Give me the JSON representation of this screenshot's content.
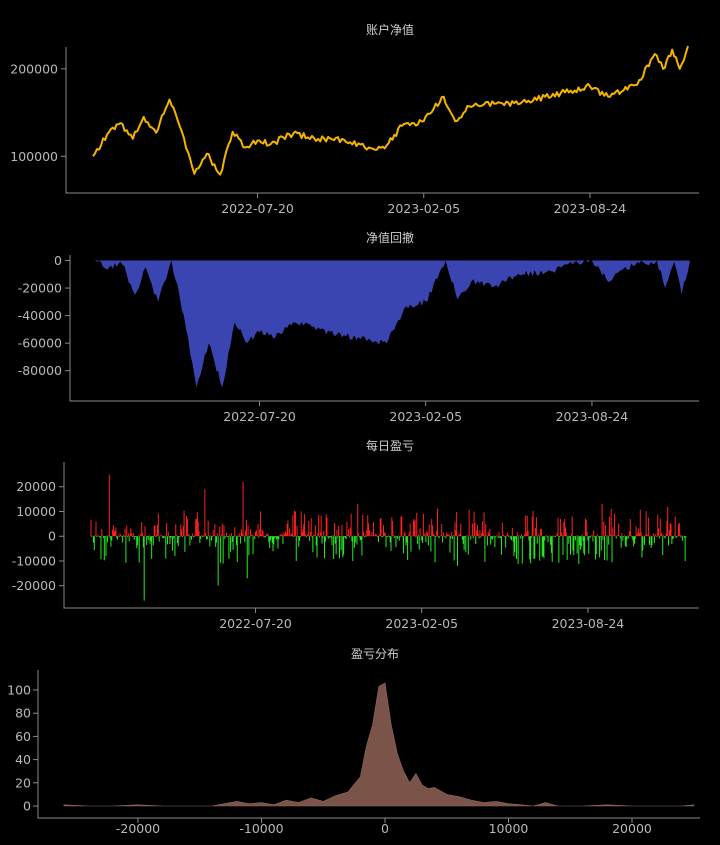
{
  "chart_data": [
    {
      "type": "line",
      "title": "账户净值",
      "x_ticks": [
        "2022-07-20",
        "2023-02-05",
        "2023-08-24"
      ],
      "y_ticks": [
        100000,
        200000
      ],
      "ylim": [
        58000,
        225000
      ],
      "series_color": "#f5b400",
      "series": [
        {
          "x": [
            "2022-01-03",
            "2022-01-20",
            "2022-02-05",
            "2022-02-20",
            "2022-03-05",
            "2022-03-20",
            "2022-04-05",
            "2022-04-20",
            "2022-05-05",
            "2022-05-20",
            "2022-06-05",
            "2022-06-20",
            "2022-07-05",
            "2022-07-20",
            "2022-08-05",
            "2022-09-01",
            "2022-10-01",
            "2022-11-01",
            "2022-12-01",
            "2022-12-20",
            "2023-01-10",
            "2023-02-05",
            "2023-03-01",
            "2023-03-15",
            "2023-04-01",
            "2023-05-01",
            "2023-06-01",
            "2023-07-01",
            "2023-08-01",
            "2023-08-24",
            "2023-09-15",
            "2023-10-01",
            "2023-10-20",
            "2023-11-10",
            "2023-11-20",
            "2023-12-01",
            "2023-12-10",
            "2023-12-20"
          ],
          "y": [
            100000,
            125000,
            138000,
            120000,
            145000,
            127000,
            165000,
            128000,
            80000,
            103000,
            79000,
            128000,
            110000,
            118000,
            114000,
            126000,
            120000,
            119000,
            110000,
            109000,
            135000,
            140000,
            168000,
            140000,
            157000,
            160000,
            160000,
            168000,
            175000,
            180000,
            168000,
            174000,
            182000,
            217000,
            200000,
            222000,
            200000,
            226000
          ]
        }
      ]
    },
    {
      "type": "area",
      "title": "净值回撤",
      "x_ticks": [
        "2022-07-20",
        "2023-02-05",
        "2023-08-24"
      ],
      "y_ticks": [
        0,
        -20000,
        -40000,
        -60000,
        -80000
      ],
      "ylim": [
        -102000,
        4000
      ],
      "series_color": "#3a45b2",
      "series": [
        {
          "x": [
            "2022-01-03",
            "2022-01-20",
            "2022-02-05",
            "2022-02-20",
            "2022-03-05",
            "2022-03-20",
            "2022-04-05",
            "2022-04-20",
            "2022-05-05",
            "2022-05-20",
            "2022-06-05",
            "2022-06-20",
            "2022-07-05",
            "2022-07-20",
            "2022-08-05",
            "2022-09-01",
            "2022-10-01",
            "2022-11-01",
            "2022-12-01",
            "2022-12-20",
            "2023-01-10",
            "2023-02-05",
            "2023-03-01",
            "2023-03-15",
            "2023-04-01",
            "2023-05-01",
            "2023-06-01",
            "2023-07-01",
            "2023-08-01",
            "2023-08-24",
            "2023-09-15",
            "2023-10-01",
            "2023-10-20",
            "2023-11-10",
            "2023-11-20",
            "2023-12-01",
            "2023-12-10",
            "2023-12-20"
          ],
          "y": [
            0,
            -5000,
            -3000,
            -25000,
            -5000,
            -30000,
            0,
            -40000,
            -92000,
            -60000,
            -92000,
            -45000,
            -60000,
            -52000,
            -56000,
            -45000,
            -50000,
            -55000,
            -58000,
            -60000,
            -35000,
            -30000,
            0,
            -28000,
            -15000,
            -18000,
            -10000,
            -8000,
            -3000,
            0,
            -15000,
            -6000,
            -2000,
            0,
            -20000,
            -1000,
            -25000,
            0
          ]
        }
      ]
    },
    {
      "type": "bar",
      "title": "每日盈亏",
      "x_ticks": [
        "2022-07-20",
        "2023-02-05",
        "2023-08-24"
      ],
      "y_ticks": [
        20000,
        10000,
        0,
        -10000,
        -20000
      ],
      "ylim": [
        -29000,
        30000
      ],
      "colors": {
        "positive": "#ff2020",
        "negative": "#22ee22"
      },
      "note": "daily values shown are approximate; bars generated pseudo-randomly with largest visible spikes reproduced",
      "spikes": [
        {
          "date": "2022-01-25",
          "value": 25000
        },
        {
          "date": "2022-03-08",
          "value": -26000
        },
        {
          "date": "2022-05-20",
          "value": 19000
        },
        {
          "date": "2022-06-05",
          "value": -20000
        },
        {
          "date": "2022-07-05",
          "value": 22000
        },
        {
          "date": "2022-07-10",
          "value": -17000
        },
        {
          "date": "2022-11-20",
          "value": 13000
        },
        {
          "date": "2023-03-20",
          "value": -12000
        },
        {
          "date": "2023-09-10",
          "value": 13000
        },
        {
          "date": "2023-11-28",
          "value": 12000
        }
      ]
    },
    {
      "type": "area",
      "title": "盈亏分布",
      "x_ticks": [
        -20000,
        -10000,
        0,
        10000,
        20000
      ],
      "y_ticks": [
        0,
        20,
        40,
        60,
        80,
        100
      ],
      "xlim": [
        -27000,
        27000
      ],
      "ylim": [
        -6,
        112
      ],
      "series_color": "#7b5449",
      "series": [
        {
          "x": [
            -26000,
            -24000,
            -22000,
            -20000,
            -18000,
            -16000,
            -14000,
            -13000,
            -12000,
            -11000,
            -10000,
            -9000,
            -8000,
            -7000,
            -6000,
            -5000,
            -4000,
            -3000,
            -2000,
            -1500,
            -1000,
            -500,
            0,
            500,
            1000,
            1500,
            2000,
            2500,
            3000,
            3500,
            4000,
            5000,
            6000,
            7000,
            8000,
            9000,
            10000,
            11000,
            12000,
            13000,
            14000,
            16000,
            18000,
            20000,
            22000,
            24000,
            25000
          ],
          "y": [
            1,
            0,
            0,
            1,
            0,
            0,
            0,
            2,
            4,
            2,
            3,
            1,
            5,
            3,
            7,
            4,
            9,
            12,
            25,
            52,
            70,
            103,
            106,
            70,
            45,
            30,
            20,
            28,
            18,
            15,
            16,
            10,
            8,
            5,
            3,
            4,
            2,
            1,
            0,
            3,
            0,
            0,
            1,
            0,
            0,
            0,
            1
          ]
        }
      ]
    }
  ]
}
